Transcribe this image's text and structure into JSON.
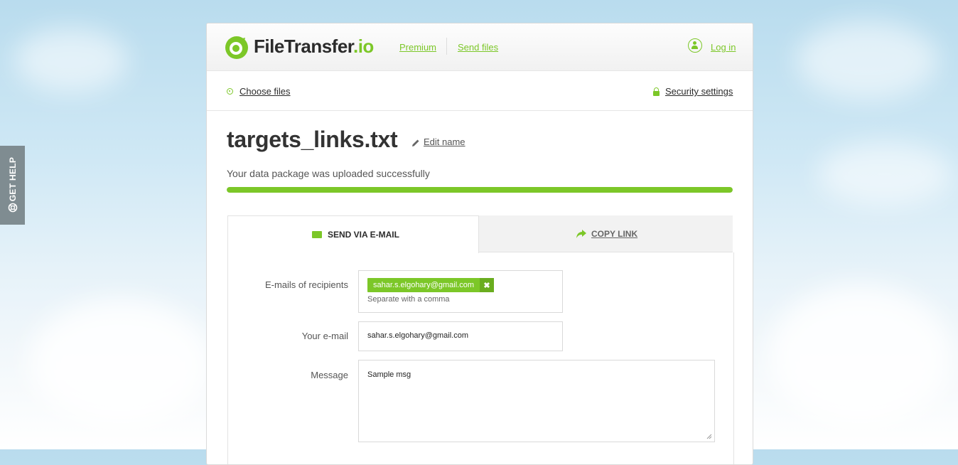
{
  "brand": {
    "name_main": "FileTransfer",
    "name_suffix": ".io",
    "accent": "#7cc728"
  },
  "nav": {
    "premium": "Premium",
    "send_files": "Send files",
    "login": "Log in"
  },
  "help": {
    "label": "GET HELP"
  },
  "subbar": {
    "choose_files": "Choose files",
    "security_settings": "Security settings"
  },
  "upload": {
    "filename": "targets_links.txt",
    "edit_name": "Edit name",
    "status": "Your data package was uploaded successfully",
    "progress_percent": 100
  },
  "tabs": {
    "send_email": "SEND VIA E-MAIL",
    "copy_link": "COPY LINK"
  },
  "form": {
    "recipients_label": "E-mails of recipients",
    "recipient_chip": "sahar.s.elgohary@gmail.com",
    "recipient_remove": "✖",
    "recipients_hint": "Separate with a comma",
    "your_email_label": "Your e-mail",
    "your_email_value": "sahar.s.elgohary@gmail.com",
    "message_label": "Message",
    "message_value": "Sample msg"
  }
}
